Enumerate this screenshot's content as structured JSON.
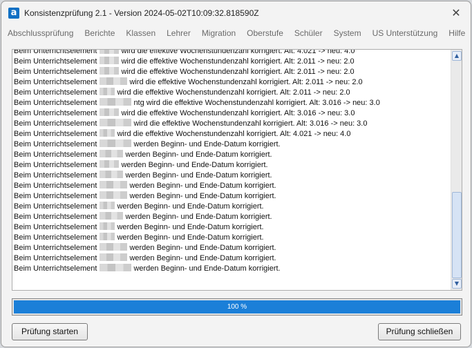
{
  "window": {
    "title": "Konsistenzprüfung 2.1 - Version 2024-05-02T10:09:32.818590Z",
    "app_icon_letter": "a",
    "close_glyph": "✕"
  },
  "menu": [
    "Abschlussprüfung",
    "Berichte",
    "Klassen",
    "Lehrer",
    "Migration",
    "Oberstufe",
    "Schüler",
    "System",
    "US Unterstützung",
    "Hilfe"
  ],
  "log": {
    "prefix": "Beim Unterrichtselement",
    "lines": [
      {
        "r": 1,
        "text": "wird die effektive Wochenstundenzahl korrigiert. Alt: 4.021 -> neu: 4.0"
      },
      {
        "r": 1,
        "text": "wird die effektive Wochenstundenzahl korrigiert. Alt: 2.011 -> neu: 2.0"
      },
      {
        "r": 1,
        "text": "wird die effektive Wochenstundenzahl korrigiert. Alt: 2.011 -> neu: 2.0"
      },
      {
        "r": 3,
        "text": "wird die effektive Wochenstundenzahl korrigiert. Alt: 2.011 -> neu: 2.0"
      },
      {
        "r": 5,
        "text": "wird die effektive Wochenstundenzahl korrigiert. Alt: 2.011 -> neu: 2.0"
      },
      {
        "r": 4,
        "text": "ntg wird die effektive Wochenstundenzahl korrigiert. Alt: 3.016 -> neu: 3.0"
      },
      {
        "r": 1,
        "text": "wird die effektive Wochenstundenzahl korrigiert. Alt: 3.016 -> neu: 3.0"
      },
      {
        "r": 4,
        "text": "wird die effektive Wochenstundenzahl korrigiert. Alt: 3.016 -> neu: 3.0"
      },
      {
        "r": 5,
        "text": "wird die effektive Wochenstundenzahl korrigiert. Alt: 4.021 -> neu: 4.0"
      },
      {
        "r": 4,
        "text": "werden Beginn- und Ende-Datum korrigiert."
      },
      {
        "r": 2,
        "text": "werden Beginn- und Ende-Datum korrigiert."
      },
      {
        "r": 1,
        "text": "werden Beginn- und Ende-Datum korrigiert."
      },
      {
        "r": 2,
        "text": "werden Beginn- und Ende-Datum korrigiert."
      },
      {
        "r": 3,
        "text": "werden Beginn- und Ende-Datum korrigiert."
      },
      {
        "r": 3,
        "text": "werden Beginn- und Ende-Datum korrigiert."
      },
      {
        "r": 5,
        "text": "werden Beginn- und Ende-Datum korrigiert."
      },
      {
        "r": 2,
        "text": "werden Beginn- und Ende-Datum korrigiert."
      },
      {
        "r": 0,
        "text": "werden Beginn- und Ende-Datum korrigiert."
      },
      {
        "r": 0,
        "text": "werden Beginn- und Ende-Datum korrigiert."
      },
      {
        "r": 3,
        "text": "werden Beginn- und Ende-Datum korrigiert."
      },
      {
        "r": 3,
        "text": "werden Beginn- und Ende-Datum korrigiert."
      },
      {
        "r": 4,
        "text": "werden Beginn- und Ende-Datum korrigiert."
      }
    ]
  },
  "progress": {
    "value": 1.0,
    "label": "100 %"
  },
  "buttons": {
    "start": "Prüfung starten",
    "close": "Prüfung schließen"
  }
}
